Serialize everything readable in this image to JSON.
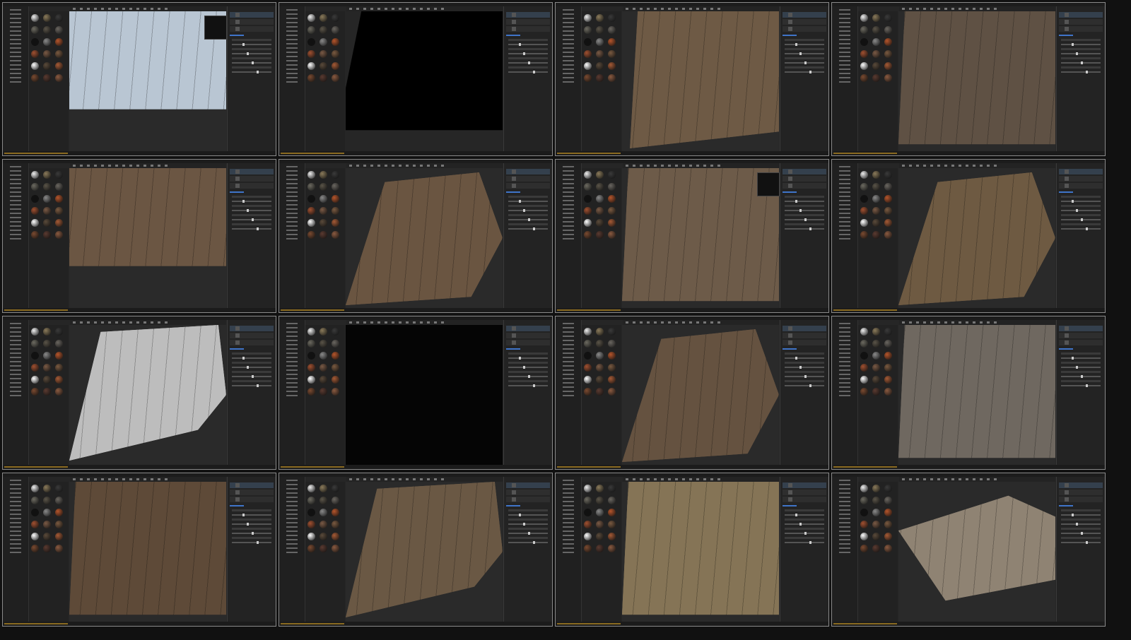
{
  "frames": [
    {
      "viewport_tone": "#b9c6d3",
      "viewport_bg": "#2a2a2a",
      "plane": "wide-top",
      "dropdown_open": true
    },
    {
      "viewport_tone": "#000000",
      "viewport_bg": "#262626",
      "plane": "black-tilted",
      "dropdown_open": false
    },
    {
      "viewport_tone": "#6e5a45",
      "viewport_bg": "#2a2a2a",
      "plane": "perspective-left",
      "dropdown_open": false
    },
    {
      "viewport_tone": "#5f5144",
      "viewport_bg": "#2a2a2a",
      "plane": "full",
      "dropdown_open": false
    },
    {
      "viewport_tone": "#6b5643",
      "viewport_bg": "#2a2a2a",
      "plane": "wide-top",
      "dropdown_open": false
    },
    {
      "viewport_tone": "#6a5541",
      "viewport_bg": "#2a2a2a",
      "plane": "perspective-right",
      "dropdown_open": false
    },
    {
      "viewport_tone": "#6d5b49",
      "viewport_bg": "#2a2a2a",
      "plane": "full",
      "dropdown_open": true
    },
    {
      "viewport_tone": "#6e5a42",
      "viewport_bg": "#2a2a2a",
      "plane": "perspective-right",
      "dropdown_open": false
    },
    {
      "viewport_tone": "#bdbdbd",
      "viewport_bg": "#2a2a2a",
      "plane": "diamond",
      "dropdown_open": false
    },
    {
      "viewport_tone": "#050505",
      "viewport_bg": "#262626",
      "plane": "black-full",
      "dropdown_open": false
    },
    {
      "viewport_tone": "#655240",
      "viewport_bg": "#2a2a2a",
      "plane": "perspective-right",
      "dropdown_open": false
    },
    {
      "viewport_tone": "#6f6860",
      "viewport_bg": "#2a2a2a",
      "plane": "full",
      "dropdown_open": false
    },
    {
      "viewport_tone": "#5e4a38",
      "viewport_bg": "#2a2a2a",
      "plane": "full",
      "dropdown_open": false
    },
    {
      "viewport_tone": "#6a5844",
      "viewport_bg": "#2a2a2a",
      "plane": "diamond",
      "dropdown_open": false
    },
    {
      "viewport_tone": "#857456",
      "viewport_bg": "#2a2a2a",
      "plane": "full",
      "dropdown_open": false
    },
    {
      "viewport_tone": "#8f8373",
      "viewport_bg": "#2a2a2a",
      "plane": "flat-right",
      "dropdown_open": false
    }
  ],
  "colors": {
    "accent": "#3f74c9",
    "warning": "#8a6a20",
    "border": "#8a8a8a"
  },
  "material_swatches": [
    "#eeeeee",
    "#8a7a5a",
    "#3a3a3a",
    "#6c6a60",
    "#5a5448",
    "#6a6660",
    "#111111",
    "#8a8a8a",
    "#b5552b",
    "#a05030",
    "#7a5a45",
    "#7a5a40",
    "#ffffff",
    "#5a4a3a",
    "#a55a35",
    "#7a4a30",
    "#5a3a30",
    "#8a5a40"
  ]
}
